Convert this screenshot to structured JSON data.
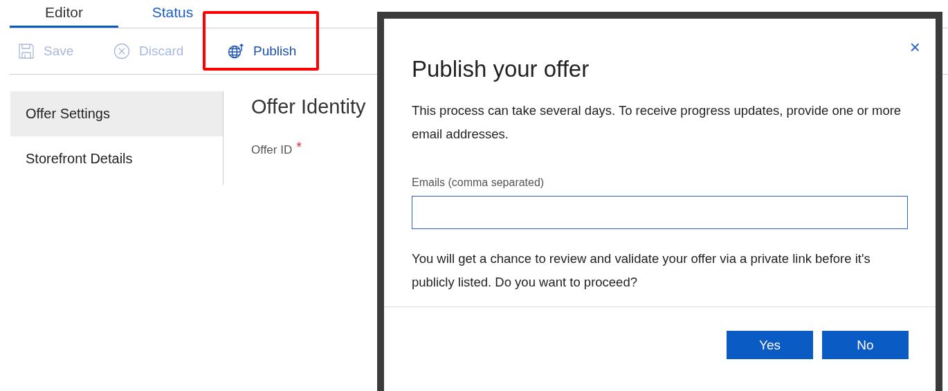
{
  "tabs": [
    {
      "label": "Editor",
      "selected": true
    },
    {
      "label": "Status",
      "selected": false
    }
  ],
  "toolbar": [
    {
      "kind": "save",
      "label": "Save",
      "disabled": true,
      "highlighted": false
    },
    {
      "kind": "discard",
      "label": "Discard",
      "disabled": true,
      "highlighted": false
    },
    {
      "kind": "publish",
      "label": "Publish",
      "disabled": false,
      "highlighted": true
    }
  ],
  "sidebar": {
    "items": [
      {
        "label": "Offer Settings",
        "selected": true
      },
      {
        "label": "Storefront Details",
        "selected": false
      }
    ]
  },
  "content": {
    "heading": "Offer Identity",
    "field": {
      "label": "Offer ID",
      "required_mark": "*"
    }
  },
  "dialog": {
    "title": "Publish your offer",
    "close": "×",
    "message": "This process can take several days. To receive progress updates, provide one or more email addresses.",
    "email_label": "Emails (comma separated)",
    "note": "You will get a chance to review and validate your offer via a private link before it's publicly listed. Do you want to proceed?",
    "buttons": [
      "Yes",
      "No"
    ]
  }
}
